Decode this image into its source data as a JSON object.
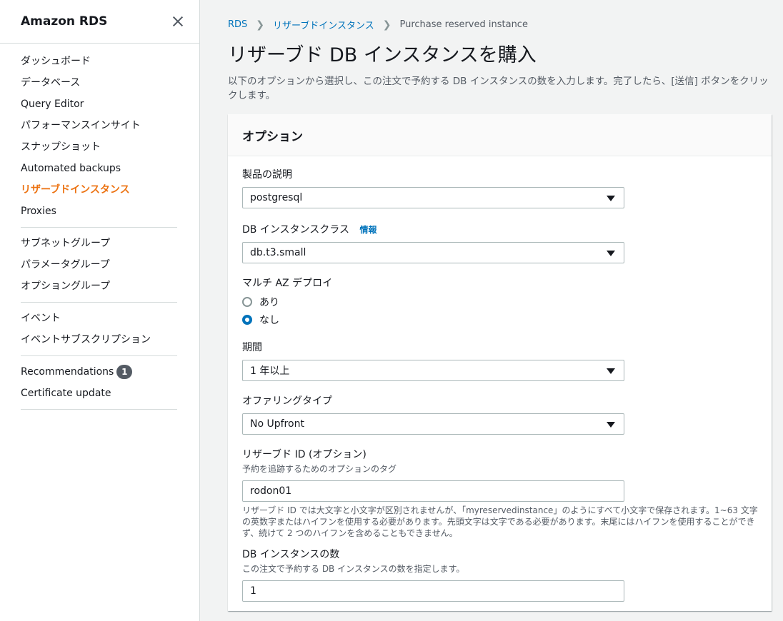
{
  "sidebar": {
    "title": "Amazon RDS",
    "group1": [
      {
        "label": "ダッシュボード"
      },
      {
        "label": "データベース"
      },
      {
        "label": "Query Editor"
      },
      {
        "label": "パフォーマンスインサイト"
      },
      {
        "label": "スナップショット"
      },
      {
        "label": "Automated backups"
      },
      {
        "label": "リザーブドインスタンス",
        "active": true
      },
      {
        "label": "Proxies"
      }
    ],
    "group2": [
      {
        "label": "サブネットグループ"
      },
      {
        "label": "パラメータグループ"
      },
      {
        "label": "オプショングループ"
      }
    ],
    "group3": [
      {
        "label": "イベント"
      },
      {
        "label": "イベントサブスクリプション"
      }
    ],
    "group4": [
      {
        "label": "Recommendations",
        "badge": "1"
      },
      {
        "label": "Certificate update"
      }
    ]
  },
  "breadcrumb": {
    "items": [
      "RDS",
      "リザーブドインスタンス"
    ],
    "current": "Purchase reserved instance"
  },
  "page": {
    "title": "リザーブド DB インスタンスを購入",
    "description": "以下のオプションから選択し、この注文で予約する DB インスタンスの数を入力します。完了したら、[送信] ボタンをクリックします。"
  },
  "panel": {
    "title": "オプション",
    "product": {
      "label": "製品の説明",
      "value": "postgresql"
    },
    "instance_class": {
      "label": "DB インスタンスクラス",
      "info": "情報",
      "value": "db.t3.small"
    },
    "multi_az": {
      "label": "マルチ AZ デプロイ",
      "options": [
        "あり",
        "なし"
      ],
      "selected": "なし"
    },
    "term": {
      "label": "期間",
      "value": "1 年以上"
    },
    "offering": {
      "label": "オファリングタイプ",
      "value": "No Upfront"
    },
    "reserved_id": {
      "label": "リザーブド ID (オプション)",
      "hint": "予約を追跡するためのオプションのタグ",
      "value": "rodon01",
      "constraint": "リザーブド ID では大文字と小文字が区別されませんが、「myreservedinstance」のようにすべて小文字で保存されます。1~63 文字の英数字またはハイフンを使用する必要があります。先頭文字は文字である必要があります。末尾にはハイフンを使用することができず、続けて 2 つのハイフンを含めることもできません。"
    },
    "count": {
      "label": "DB インスタンスの数",
      "hint": "この注文で予約する DB インスタンスの数を指定します。",
      "value": "1"
    }
  }
}
